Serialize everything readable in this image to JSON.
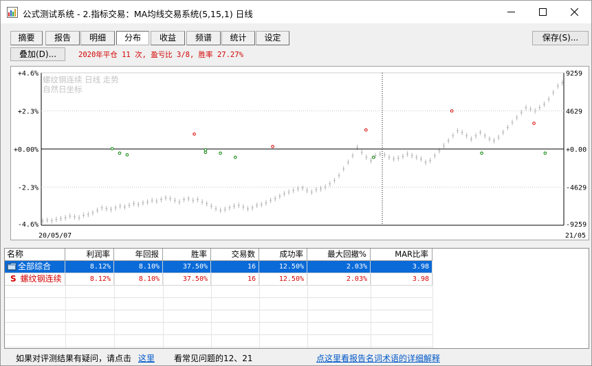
{
  "window": {
    "title": "公式测试系统 - 2.指标交易：MA均线交易系统(5,15,1) 日线"
  },
  "tabs": [
    {
      "label": "摘要",
      "active": false
    },
    {
      "label": "报告",
      "active": false
    },
    {
      "label": "明细",
      "active": false
    },
    {
      "label": "分布",
      "active": true
    },
    {
      "label": "收益",
      "active": false
    },
    {
      "label": "频谱",
      "active": false
    },
    {
      "label": "统计",
      "active": false
    },
    {
      "label": "设定",
      "active": false
    }
  ],
  "toolbar": {
    "save_label": "保存(S)...",
    "overlay_label": "叠加(D)...",
    "summary": "2020年平仓 11 次, 盈亏比 3/8, 胜率 27.27%"
  },
  "chart_data": {
    "type": "scatter",
    "title": "螺纹钢连续 日线 走势",
    "subtitle": "自然日坐标",
    "y_left_ticks": [
      "+4.6%",
      "+2.3%",
      "+0.00%",
      "-2.3%",
      "-4.6%"
    ],
    "y_right_ticks": [
      "9259",
      "4629",
      "+0.00",
      "-4629",
      "-9259"
    ],
    "y_left_range": [
      -4.6,
      4.6
    ],
    "x_labels": [
      "20/05/07",
      "21/05"
    ],
    "gain_points": [
      {
        "x": 0.41,
        "y": 0.9
      },
      {
        "x": 0.62,
        "y": 0.15
      },
      {
        "x": 0.87,
        "y": 1.15
      },
      {
        "x": 1.1,
        "y": 2.3
      },
      {
        "x": 1.32,
        "y": 1.55
      }
    ],
    "loss_points": [
      {
        "x": 0.19,
        "y": 0.02
      },
      {
        "x": 0.21,
        "y": -0.25
      },
      {
        "x": 0.23,
        "y": -0.35
      },
      {
        "x": 0.44,
        "y": -0.05
      },
      {
        "x": 0.44,
        "y": -0.2
      },
      {
        "x": 0.48,
        "y": -0.25
      },
      {
        "x": 0.52,
        "y": -0.5
      },
      {
        "x": 0.89,
        "y": -0.5
      },
      {
        "x": 1.18,
        "y": -0.25
      },
      {
        "x": 1.35,
        "y": -0.25
      }
    ],
    "price_series": [
      -4.35,
      -4.3,
      -4.33,
      -4.25,
      -4.2,
      -4.15,
      -4.05,
      -4.1,
      -4.15,
      -4.0,
      -3.95,
      -3.85,
      -3.7,
      -3.55,
      -3.6,
      -3.65,
      -3.55,
      -3.45,
      -3.5,
      -3.4,
      -3.3,
      -3.35,
      -3.25,
      -3.2,
      -3.1,
      -3.15,
      -3.05,
      -2.95,
      -3.0,
      -3.1,
      -3.2,
      -3.05,
      -3.0,
      -3.1,
      -3.05,
      -3.2,
      -3.3,
      -3.45,
      -3.6,
      -3.7,
      -3.65,
      -3.55,
      -3.45,
      -3.4,
      -3.5,
      -3.6,
      -3.55,
      -3.4,
      -3.35,
      -3.25,
      -3.1,
      -3.0,
      -2.85,
      -2.7,
      -2.6,
      -2.5,
      -2.4,
      -2.35,
      -2.5,
      -2.6,
      -2.45,
      -2.4,
      -2.3,
      -2.1,
      -1.9,
      -1.6,
      -1.2,
      -0.8,
      -0.4,
      0.1,
      -0.2,
      -0.5,
      -0.7,
      -0.4,
      -0.3,
      -0.35,
      -0.5,
      -0.6,
      -0.55,
      -0.45,
      -0.3,
      -0.4,
      -0.5,
      -0.6,
      -0.8,
      -0.7,
      -0.4,
      -0.1,
      0.2,
      0.5,
      0.8,
      1.1,
      1.0,
      0.8,
      0.6,
      0.8,
      1.0,
      0.8,
      0.6,
      0.5,
      0.7,
      1.0,
      1.3,
      1.6,
      1.9,
      2.2,
      2.5,
      2.4,
      2.3,
      2.5,
      2.7,
      3.0,
      3.4,
      3.8,
      4.0
    ]
  },
  "table": {
    "columns": [
      "名称",
      "利润率",
      "年回报",
      "胜率",
      "交易数",
      "成功率",
      "最大回撤%",
      "MAR比率"
    ],
    "rows": [
      {
        "icon": "folder-icon",
        "name": "全部综合",
        "values": [
          "8.12%",
          "8.10%",
          "37.50%",
          "16",
          "12.50%",
          "2.03%",
          "3.98"
        ]
      },
      {
        "icon": "S",
        "name": "螺纹钢连续",
        "values": [
          "8.12%",
          "8.10%",
          "37.50%",
          "16",
          "12.50%",
          "2.03%",
          "3.98"
        ]
      }
    ]
  },
  "statusbar": {
    "prompt": "如果对评测结果有疑问，请点击",
    "here_link": "这里",
    "faq": "看常见问题的12、21",
    "glossary_link": "点这里看报告名词术语的详细解释"
  },
  "colors": {
    "gain": "#d40000",
    "loss": "#008000",
    "price_bars": "#b4b4b4",
    "selection": "#0a6ad8"
  }
}
